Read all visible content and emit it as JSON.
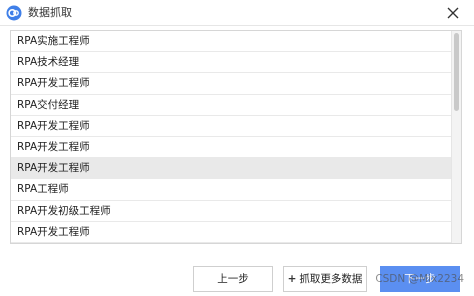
{
  "window": {
    "title": "数据抓取",
    "icon": "app-logo-icon"
  },
  "list": {
    "items": [
      {
        "label": "RPA实施工程师",
        "selected": false
      },
      {
        "label": "RPA技术经理",
        "selected": false
      },
      {
        "label": "RPA开发工程师",
        "selected": false
      },
      {
        "label": "RPA交付经理",
        "selected": false
      },
      {
        "label": "RPA开发工程师",
        "selected": false
      },
      {
        "label": "RPA开发工程师",
        "selected": false
      },
      {
        "label": "RPA开发工程师",
        "selected": true
      },
      {
        "label": "RPA工程师",
        "selected": false
      },
      {
        "label": "RPA开发初级工程师",
        "selected": false
      },
      {
        "label": "RPA开发工程师",
        "selected": false
      }
    ]
  },
  "footer": {
    "prev_label": "上一步",
    "fetch_more_label": "抓取更多数据",
    "next_label": "下一步"
  },
  "watermark": {
    "text": "CSDN @Mix2234"
  },
  "colors": {
    "primary": "#5b8ff1",
    "selected_row": "#e9e9e9",
    "border": "#d6d6d6"
  }
}
